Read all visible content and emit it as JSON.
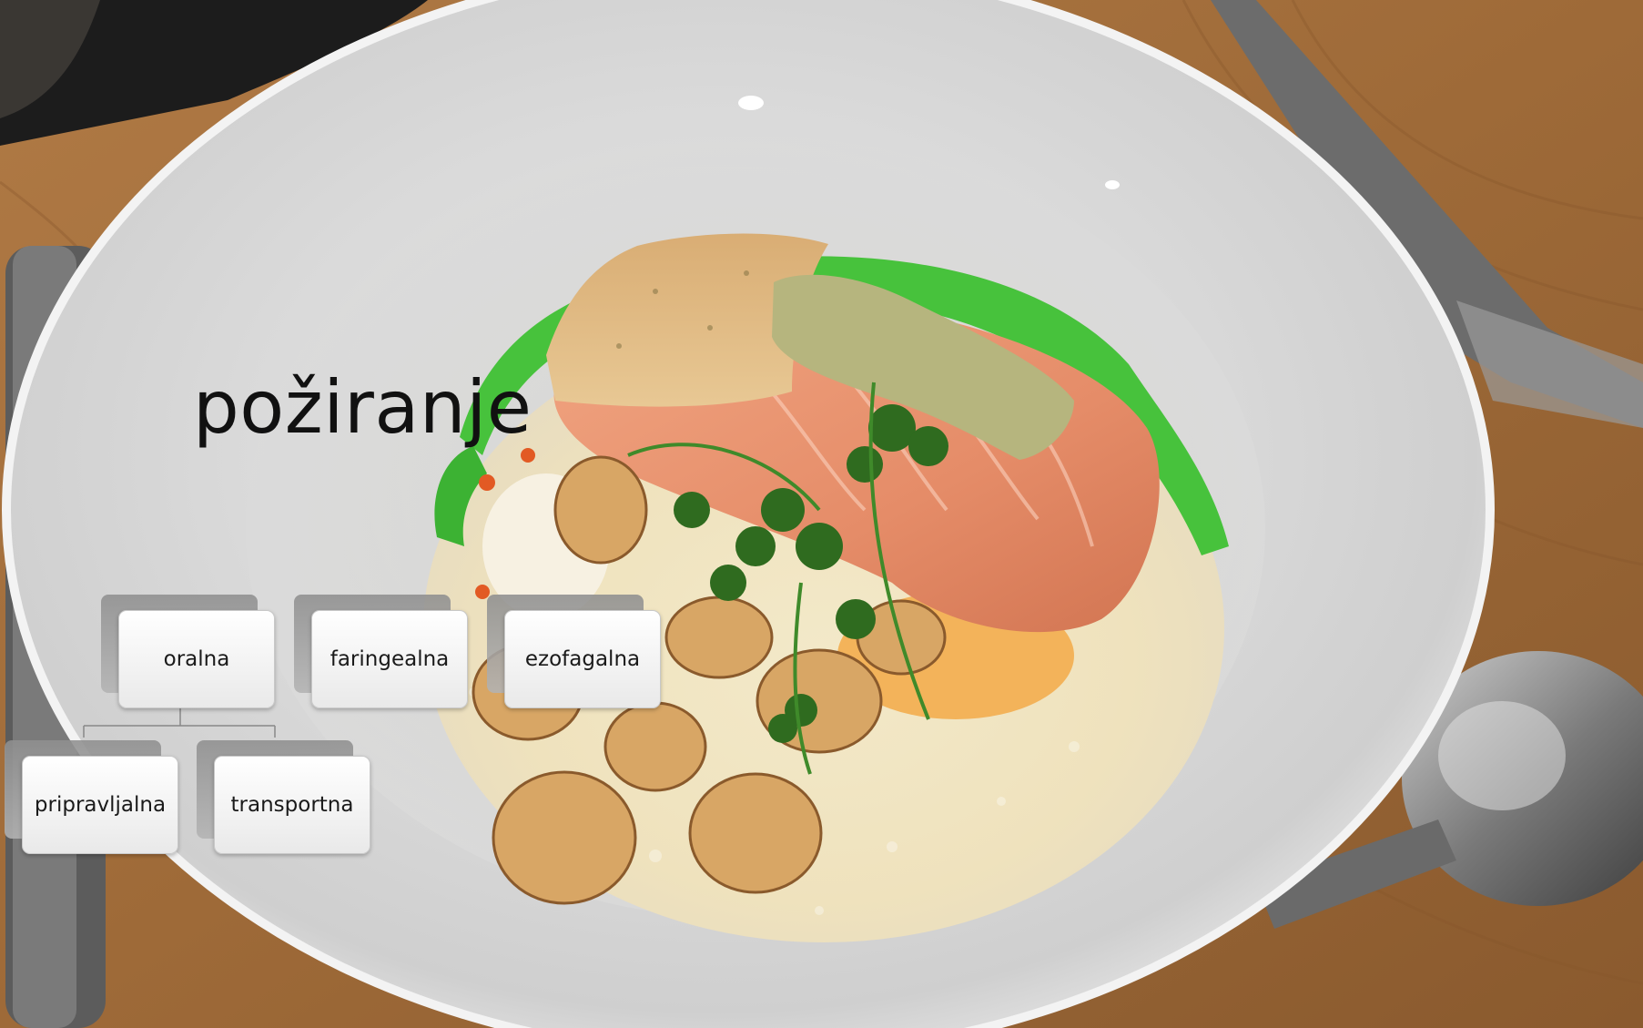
{
  "slide": {
    "title": "požiranje",
    "background_image": "poached salmon dish in a white bowl with chips, green oil and foam",
    "cards": {
      "top": [
        {
          "label": "oralna"
        },
        {
          "label": "faringealna"
        },
        {
          "label": "ezofagalna"
        }
      ],
      "bottom": [
        {
          "label": "pripravljalna"
        },
        {
          "label": "transportna"
        }
      ]
    },
    "colors": {
      "card_face": "#f4f4f4",
      "card_shadow": "#9a9a9a",
      "title": "#111111"
    }
  }
}
